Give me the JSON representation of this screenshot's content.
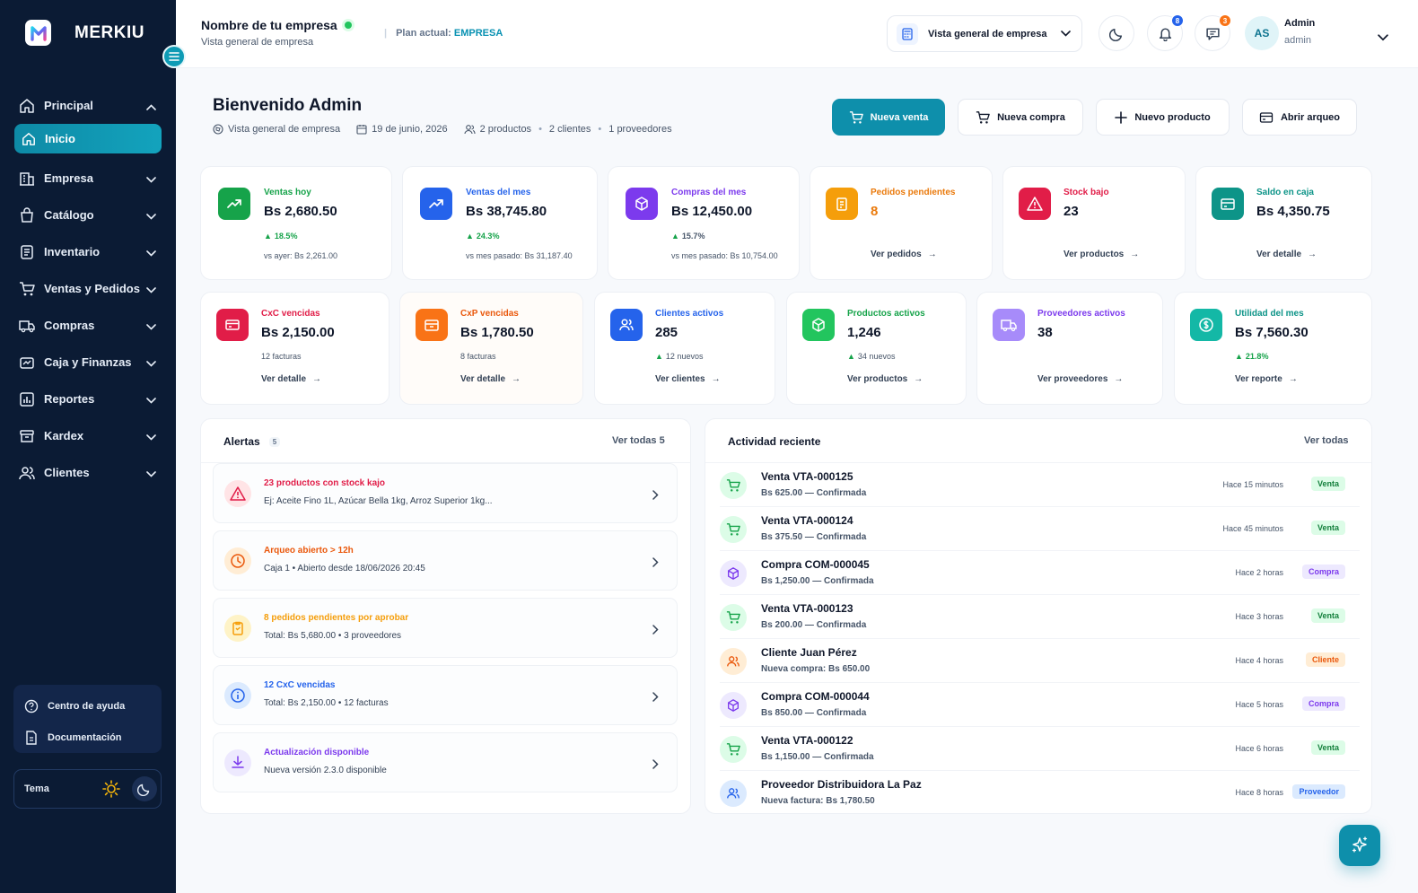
{
  "sidebar": {
    "brand": "MERKIU",
    "items": [
      {
        "label": "Principal",
        "icon": "home-icon"
      },
      {
        "label": "Inicio",
        "icon": "home-icon",
        "active": true
      },
      {
        "label": "Empresa",
        "icon": "building-icon"
      },
      {
        "label": "Catálogo",
        "icon": "bag-icon"
      },
      {
        "label": "Inventario",
        "icon": "inventory-icon"
      },
      {
        "label": "Ventas y Pedidos",
        "icon": "cart-icon"
      },
      {
        "label": "Compras",
        "icon": "truck-icon"
      },
      {
        "label": "Caja y Finanzas",
        "icon": "wallet-icon"
      },
      {
        "label": "Reportes",
        "icon": "report-icon"
      },
      {
        "label": "Kardex",
        "icon": "archive-icon"
      },
      {
        "label": "Clientes",
        "icon": "users-icon"
      }
    ],
    "help": {
      "help_center": "Centro de ayuda",
      "docs": "Documentación"
    },
    "theme_label": "Tema"
  },
  "header": {
    "company_name": "Nombre de tu empresa",
    "company_sub": "Vista general de empresa",
    "plan_label": "Plan actual:",
    "plan_value": "EMPRESA",
    "view_select": "Vista general de empresa",
    "notifications_count": "8",
    "messages_count": "3",
    "user_initials": "AS",
    "user_name": "Admin",
    "user_role": "admin"
  },
  "welcome": {
    "title": "Bienvenido Admin",
    "meta_view": "Vista general de empresa",
    "meta_date": "19 de junio, 2026",
    "meta_products": "2 productos",
    "meta_clients": "2 clientes",
    "meta_suppliers": "1 proveedores"
  },
  "actions": {
    "new_sale": "Nueva venta",
    "new_purchase": "Nueva compra",
    "new_product": "Nuevo producto",
    "open_cash": "Abrir arqueo"
  },
  "stats_row1": [
    {
      "label": "Ventas hoy",
      "value": "Bs 2,680.50",
      "change": "18.5%",
      "compare": "vs ayer: Bs 2,261.00",
      "color": "#16a34a",
      "icon_bg": "#16a34a"
    },
    {
      "label": "Ventas del mes",
      "value": "Bs 38,745.80",
      "change": "24.3%",
      "compare": "vs mes pasado: Bs 31,187.40",
      "color": "#2563eb",
      "icon_bg": "#2563eb"
    },
    {
      "label": "Compras del mes",
      "value": "Bs 12,450.00",
      "change": "15.7%",
      "compare": "vs mes pasado: Bs 10,754.00",
      "color": "#7c3aed",
      "icon_bg": "#7c3aed"
    },
    {
      "label": "Pedidos pendientes",
      "value": "8",
      "link": "Ver pedidos",
      "color": "#ea7a0c",
      "icon_bg": "#f59e0b"
    },
    {
      "label": "Stock bajo",
      "value": "23",
      "link": "Ver productos",
      "color": "#e11d48",
      "icon_bg": "#e11d48"
    },
    {
      "label": "Saldo en caja",
      "value": "Bs 4,350.75",
      "link": "Ver detalle",
      "color": "#0d9488",
      "icon_bg": "#0d9488"
    }
  ],
  "stats_row2": [
    {
      "label": "CxC vencidas",
      "value": "Bs 2,150.00",
      "sub": "12 facturas",
      "link": "Ver detalle",
      "color": "#e11d48",
      "icon_bg": "#e11d48"
    },
    {
      "label": "CxP vencidas",
      "value": "Bs 1,780.50",
      "sub": "8 facturas",
      "link": "Ver detalle",
      "color": "#ea580c",
      "icon_bg": "#f97316"
    },
    {
      "label": "Clientes activos",
      "value": "285",
      "sub": "12 nuevos",
      "link": "Ver clientes",
      "color": "#2563eb",
      "icon_bg": "#2563eb"
    },
    {
      "label": "Productos activos",
      "value": "1,246",
      "sub": "34 nuevos",
      "link": "Ver productos",
      "color": "#16a34a",
      "icon_bg": "#22c55e"
    },
    {
      "label": "Proveedores activos",
      "value": "38",
      "link": "Ver proveedores",
      "color": "#7c3aed",
      "icon_bg": "#a78bfa"
    },
    {
      "label": "Utilidad del mes",
      "value": "Bs 7,560.30",
      "sub": "21.8%",
      "link": "Ver reporte",
      "color": "#0d9488",
      "icon_bg": "#14b8a6"
    }
  ],
  "alerts": {
    "title": "Alertas",
    "count": "5",
    "view_all": "Ver todas  5",
    "items": [
      {
        "title": "23 productos con stock kajo",
        "text": "Ej: Aceite Fino 1L, Azúcar Bella 1kg, Arroz Superior 1kg...",
        "color": "#e11d48",
        "bg": "#ffe4e6"
      },
      {
        "title": "Arqueo abierto > 12h",
        "text": "Caja 1 • Abierto desde 18/06/2026 20:45",
        "color": "#ea580c",
        "bg": "#ffedd5"
      },
      {
        "title": "8 pedidos pendientes por aprobar",
        "text": "Total: Bs 5,680.00  •  3 proveedores",
        "color": "#f59e0b",
        "bg": "#fef3c7"
      },
      {
        "title": "12 CxC vencidas",
        "text": "Total: Bs 2,150.00  •  12 facturas",
        "color": "#2563eb",
        "bg": "#dbeafe"
      },
      {
        "title": "Actualización disponible",
        "text": "Nueva versión 2.3.0 disponible",
        "color": "#7c3aed",
        "bg": "#ede9fe"
      }
    ]
  },
  "activity": {
    "title": "Actividad reciente",
    "view_all": "Ver todas",
    "items": [
      {
        "title": "Venta VTA-000125",
        "sub": "Bs 625.00 — Confirmada",
        "time": "Hace 15 minutos",
        "badge": "Venta",
        "kind": "sale"
      },
      {
        "title": "Venta VTA-000124",
        "sub": "Bs 375.50 — Confirmada",
        "time": "Hace 45 minutos",
        "badge": "Venta",
        "kind": "sale"
      },
      {
        "title": "Compra COM-000045",
        "sub": "Bs 1,250.00 — Confirmada",
        "time": "Hace 2 horas",
        "badge": "Compra",
        "kind": "purchase"
      },
      {
        "title": "Venta VTA-000123",
        "sub": "Bs 200.00 — Confirmada",
        "time": "Hace 3 horas",
        "badge": "Venta",
        "kind": "sale"
      },
      {
        "title": "Cliente Juan Pérez",
        "sub": "Nueva compra: Bs 650.00",
        "time": "Hace 4 horas",
        "badge": "Cliente",
        "kind": "client"
      },
      {
        "title": "Compra COM-000044",
        "sub": "Bs 850.00 — Confirmada",
        "time": "Hace 5 horas",
        "badge": "Compra",
        "kind": "purchase"
      },
      {
        "title": "Venta VTA-000122",
        "sub": "Bs 1,150.00 — Confirmada",
        "time": "Hace 6 horas",
        "badge": "Venta",
        "kind": "sale"
      },
      {
        "title": "Proveedor Distribuidora La Paz",
        "sub": "Nueva factura: Bs 1,780.50",
        "time": "Hace 8 horas",
        "badge": "Proveedor",
        "kind": "supplier"
      }
    ]
  },
  "colors": {
    "accent": "#0e8fab",
    "sidebar_bg": "#0b1b34"
  }
}
